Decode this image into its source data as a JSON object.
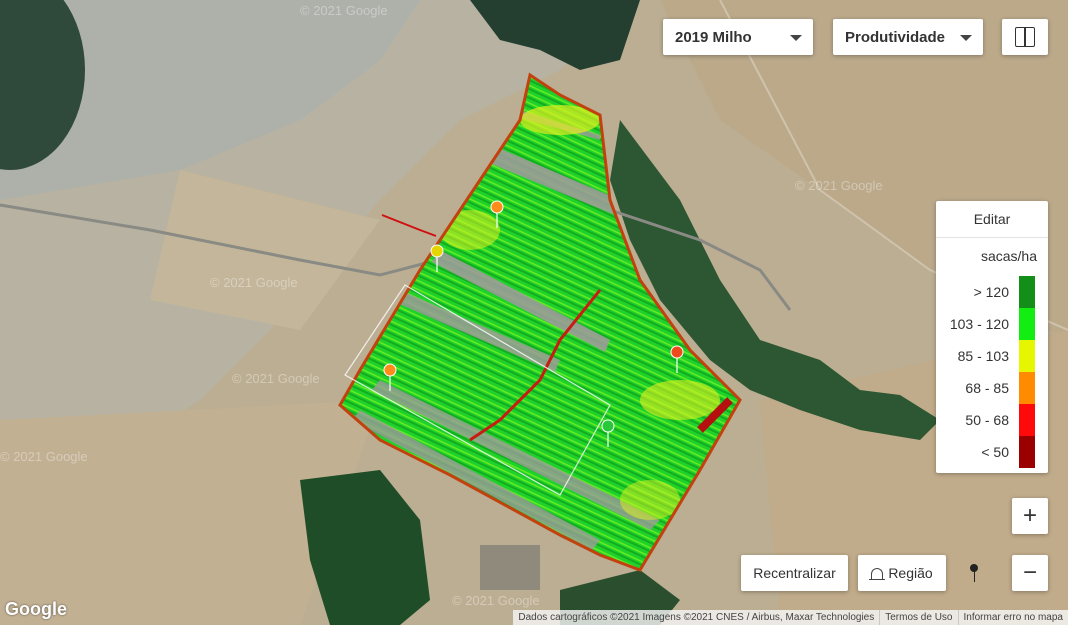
{
  "selectors": {
    "season": "2019 Milho",
    "layer": "Produtividade"
  },
  "legend": {
    "edit_label": "Editar",
    "unit": "sacas/ha",
    "classes": [
      {
        "label": "> 120",
        "color": "#138f19"
      },
      {
        "label": "103 - 120",
        "color": "#12ee12"
      },
      {
        "label": "85 - 103",
        "color": "#e6f500"
      },
      {
        "label": "68 - 85",
        "color": "#ff8c00"
      },
      {
        "label": "50 - 68",
        "color": "#ff0a0a"
      },
      {
        "label": "< 50",
        "color": "#9a0000"
      }
    ]
  },
  "buttons": {
    "recenter": "Recentralizar",
    "region": "Região",
    "zoom_in": "+",
    "zoom_out": "−"
  },
  "map": {
    "logo": "Google",
    "watermark": "© 2021 Google",
    "attribution": {
      "data": "Dados cartográficos ©2021 Imagens ©2021 CNES / Airbus, Maxar Technologies",
      "terms": "Termos de Uso",
      "report": "Informar erro no mapa"
    },
    "markers": [
      {
        "name": "marker-orange-1",
        "color": "#ff8c1a"
      },
      {
        "name": "marker-yellow",
        "color": "#e6d600"
      },
      {
        "name": "marker-orange-2",
        "color": "#ff8c1a"
      },
      {
        "name": "marker-red",
        "color": "#ef4a1e"
      },
      {
        "name": "marker-green",
        "color": "#28c83a"
      }
    ]
  },
  "icons": {
    "split_view": "split-view-icon",
    "region": "bell-icon",
    "pin": "pin-icon"
  }
}
